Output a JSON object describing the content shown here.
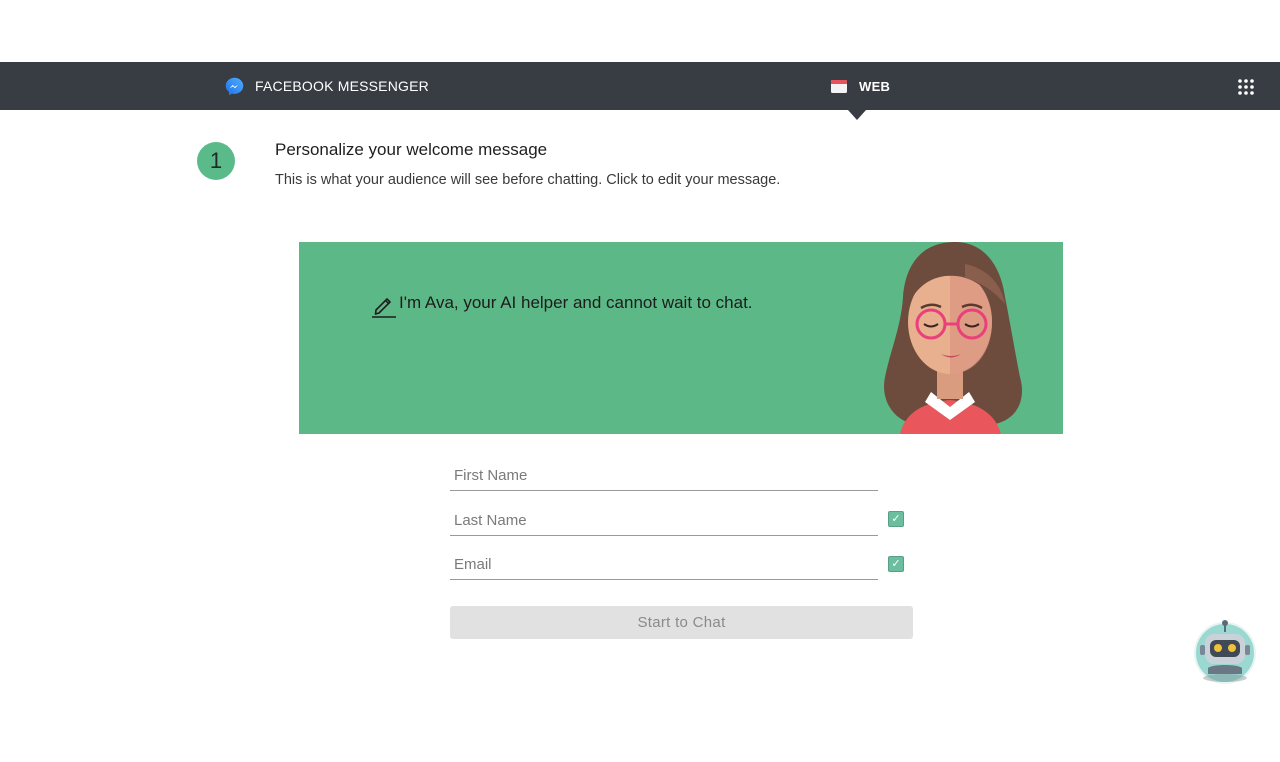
{
  "topbar": {
    "messenger_label": "FACEBOOK MESSENGER",
    "web_label": "WEB",
    "icons": [
      "messenger-icon",
      "web-browser-icon",
      "apps-grid-icon"
    ]
  },
  "step": {
    "number": "1",
    "title": "Personalize your welcome message",
    "subtitle": "This is what your audience will see before chatting. Click to edit your message."
  },
  "banner": {
    "welcome_message": "I'm Ava, your AI helper and cannot wait to chat.",
    "background": "#5cb987"
  },
  "form": {
    "first_name_placeholder": "First Name",
    "last_name_placeholder": "Last Name",
    "email_placeholder": "Email",
    "last_name_required": true,
    "email_required": true,
    "check_glyph": "✓",
    "start_label": "Start to Chat"
  },
  "colors": {
    "topbar": "#383c43",
    "accent_green": "#5bba89",
    "button_disabled": "#e1e1e1"
  }
}
